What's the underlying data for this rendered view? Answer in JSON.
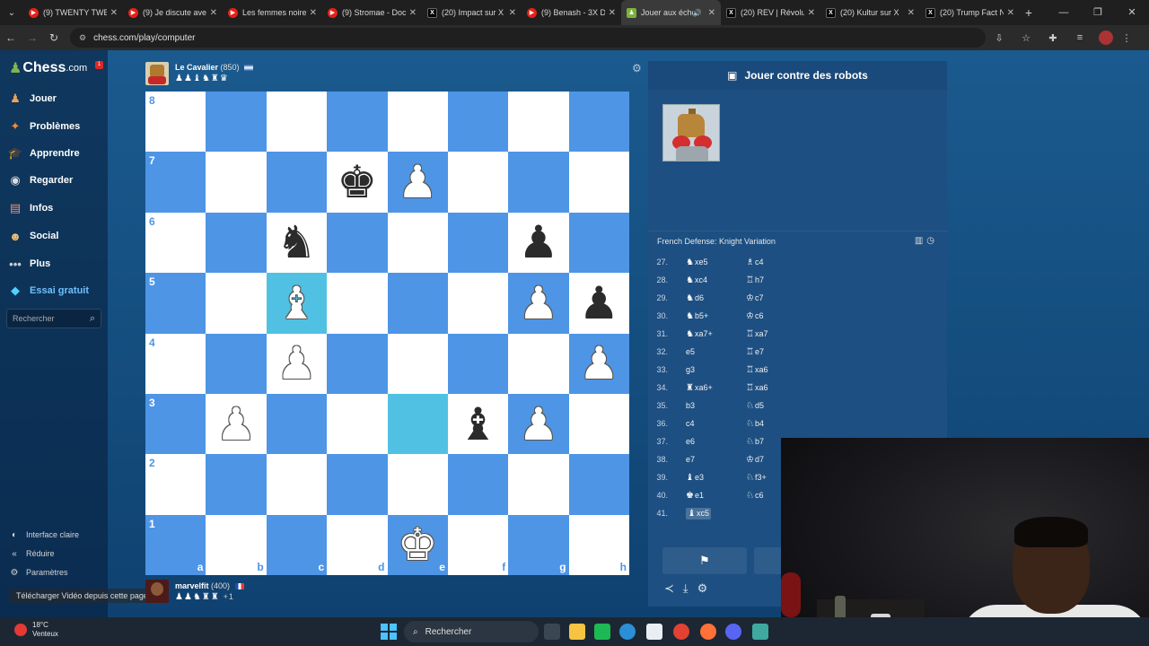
{
  "browser": {
    "tabs": [
      {
        "label": "(9) TWENTY TWE",
        "icon": "youtube-icon",
        "active": false
      },
      {
        "label": "(9) Je discute ave",
        "icon": "youtube-icon",
        "active": false
      },
      {
        "label": "Les femmes noire",
        "icon": "youtube-icon",
        "active": false
      },
      {
        "label": "(9) Stromae - Doc",
        "icon": "youtube-icon",
        "active": false
      },
      {
        "label": "(20) Impact sur X",
        "icon": "x-icon",
        "active": false
      },
      {
        "label": "(9) Benash - 3X D",
        "icon": "youtube-icon",
        "active": false
      },
      {
        "label": "Jouer aux éche",
        "icon": "chess-icon",
        "active": true
      },
      {
        "label": "(20) REV | Révolu",
        "icon": "x-icon",
        "active": false
      },
      {
        "label": "(20) Kultur sur X",
        "icon": "x-icon",
        "active": false
      },
      {
        "label": "(20) Trump Fact N",
        "icon": "x-icon",
        "active": false
      }
    ],
    "url": "chess.com/play/computer"
  },
  "sidebar": {
    "logo": "Chess",
    "logo_suffix": ".com",
    "notification_count": "1",
    "items": [
      {
        "label": "Jouer",
        "icon": "play-icon"
      },
      {
        "label": "Problèmes",
        "icon": "puzzle-icon"
      },
      {
        "label": "Apprendre",
        "icon": "learn-icon"
      },
      {
        "label": "Regarder",
        "icon": "watch-icon"
      },
      {
        "label": "Infos",
        "icon": "news-icon"
      },
      {
        "label": "Social",
        "icon": "social-icon"
      },
      {
        "label": "Plus",
        "icon": "more-icon"
      }
    ],
    "premium": "Essai gratuit",
    "search_placeholder": "Rechercher",
    "footer": [
      "Interface claire",
      "Réduire",
      "Paramètres"
    ],
    "download_tip": "Télécharger Vidéo depuis cette page"
  },
  "game": {
    "top_player": {
      "name": "Le Cavalier",
      "rating": "(850)",
      "captured": "♟♟♝♞♜♛"
    },
    "bottom_player": {
      "name": "marvelfit",
      "rating": "(400)",
      "captured": "♟♟♞♜♜",
      "extra": "+1"
    },
    "files": [
      "a",
      "b",
      "c",
      "d",
      "e",
      "f",
      "g",
      "h"
    ],
    "ranks": [
      "8",
      "7",
      "6",
      "5",
      "4",
      "3",
      "2",
      "1"
    ],
    "highlight_squares": [
      "c5",
      "e3"
    ],
    "pieces": [
      {
        "square": "d7",
        "glyph": "♚",
        "color": "b",
        "name": "black-king"
      },
      {
        "square": "e7",
        "glyph": "♟",
        "color": "w",
        "name": "white-pawn"
      },
      {
        "square": "c6",
        "glyph": "♞",
        "color": "b",
        "name": "black-knight"
      },
      {
        "square": "g6",
        "glyph": "♟",
        "color": "b",
        "name": "black-pawn"
      },
      {
        "square": "c5",
        "glyph": "♝",
        "color": "w",
        "name": "white-bishop"
      },
      {
        "square": "g5",
        "glyph": "♟",
        "color": "w",
        "name": "white-pawn"
      },
      {
        "square": "h5",
        "glyph": "♟",
        "color": "b",
        "name": "black-pawn"
      },
      {
        "square": "c4",
        "glyph": "♟",
        "color": "w",
        "name": "white-pawn"
      },
      {
        "square": "h4",
        "glyph": "♟",
        "color": "w",
        "name": "white-pawn"
      },
      {
        "square": "b3",
        "glyph": "♟",
        "color": "w",
        "name": "white-pawn"
      },
      {
        "square": "f3",
        "glyph": "♝",
        "color": "b",
        "name": "black-bishop"
      },
      {
        "square": "g3",
        "glyph": "♟",
        "color": "w",
        "name": "white-pawn"
      },
      {
        "square": "e1",
        "glyph": "♚",
        "color": "w",
        "name": "white-king"
      }
    ]
  },
  "panel": {
    "title": "Jouer contre des robots",
    "opening": "French Defense: Knight Variation",
    "moves": [
      {
        "n": "27.",
        "w": "xe5",
        "wp": "♞",
        "b": "c4",
        "bp": "♗"
      },
      {
        "n": "28.",
        "w": "xc4",
        "wp": "♞",
        "b": "h7",
        "bp": "♖"
      },
      {
        "n": "29.",
        "w": "d6",
        "wp": "♞",
        "b": "c7",
        "bp": "♔"
      },
      {
        "n": "30.",
        "w": "b5+",
        "wp": "♞",
        "b": "c6",
        "bp": "♔"
      },
      {
        "n": "31.",
        "w": "xa7+",
        "wp": "♞",
        "b": "xa7",
        "bp": "♖"
      },
      {
        "n": "32.",
        "w": "e5",
        "wp": "",
        "b": "e7",
        "bp": "♖"
      },
      {
        "n": "33.",
        "w": "g3",
        "wp": "",
        "b": "xa6",
        "bp": "♖"
      },
      {
        "n": "34.",
        "w": "xa6+",
        "wp": "♜",
        "b": "xa6",
        "bp": "♖"
      },
      {
        "n": "35.",
        "w": "b3",
        "wp": "",
        "b": "d5",
        "bp": "♘"
      },
      {
        "n": "36.",
        "w": "c4",
        "wp": "",
        "b": "b4",
        "bp": "♘"
      },
      {
        "n": "37.",
        "w": "e6",
        "wp": "",
        "b": "b7",
        "bp": "♘"
      },
      {
        "n": "38.",
        "w": "e7",
        "wp": "",
        "b": "d7",
        "bp": "♔"
      },
      {
        "n": "39.",
        "w": "e3",
        "wp": "♝",
        "b": "f3+",
        "bp": "♘"
      },
      {
        "n": "40.",
        "w": "e1",
        "wp": "♚",
        "b": "c6",
        "bp": "♘"
      },
      {
        "n": "41.",
        "w": "xc5",
        "wp": "♝",
        "b": "",
        "bp": ""
      }
    ]
  },
  "taskbar": {
    "temp": "18°C",
    "weather": "Venteux",
    "search": "Rechercher"
  }
}
